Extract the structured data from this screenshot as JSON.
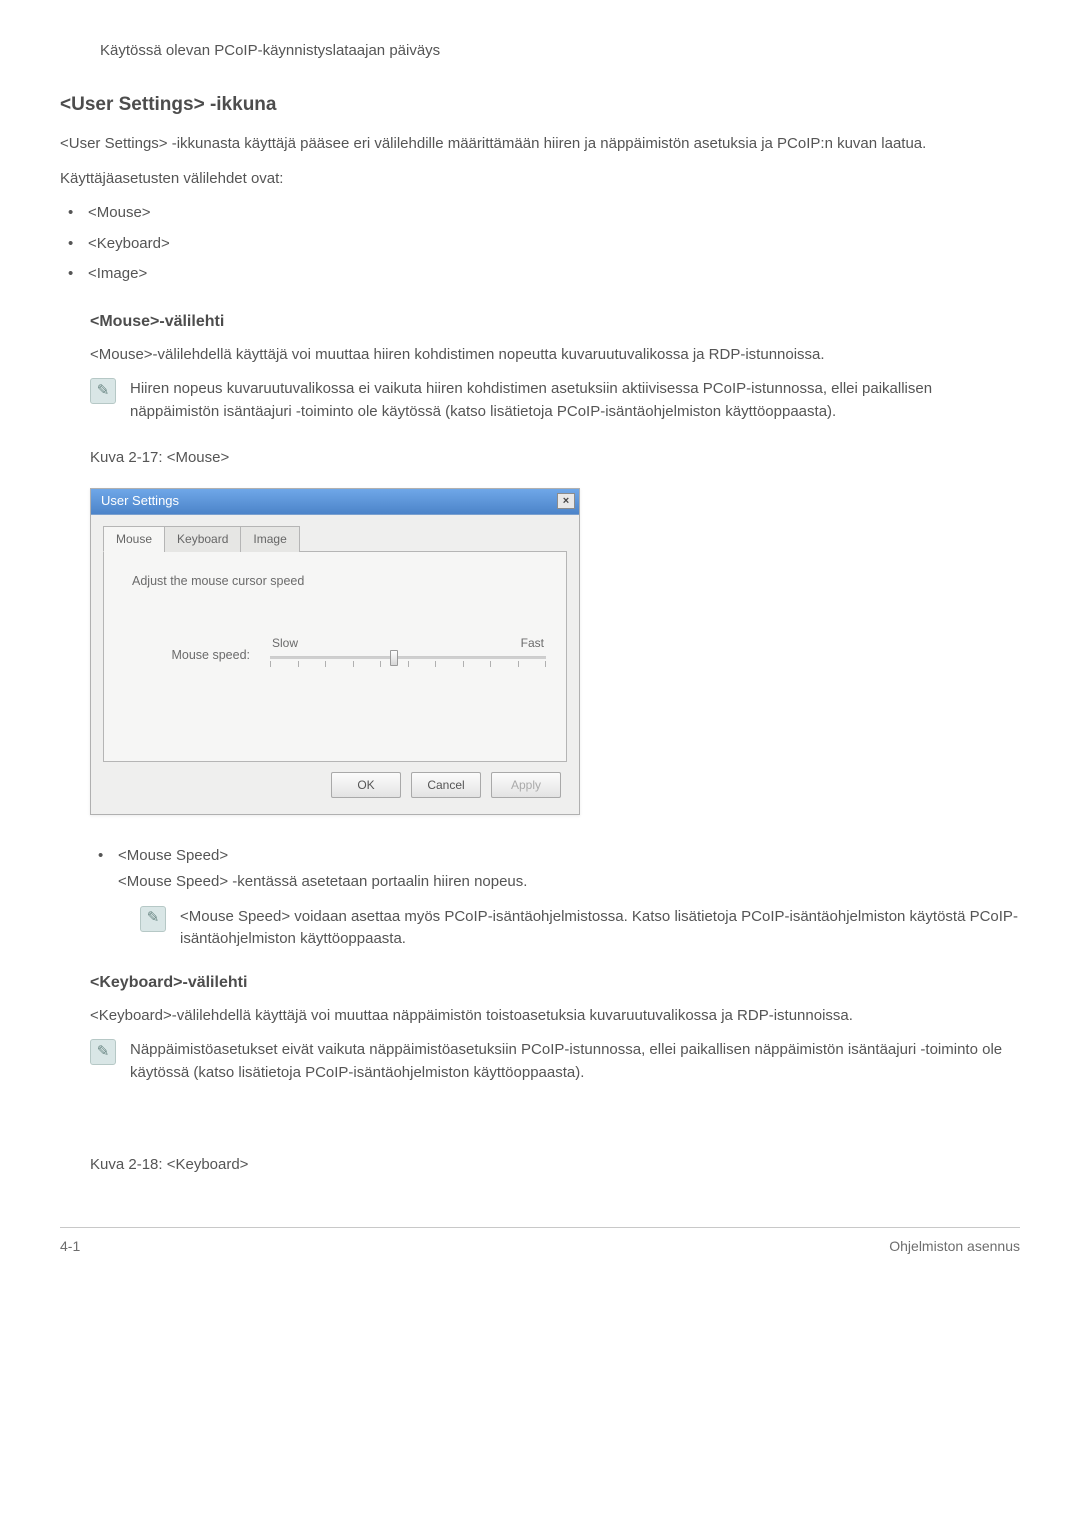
{
  "top_caption": "Käytössä olevan PCoIP-käynnistyslataajan päiväys",
  "section_title": "<User Settings> -ikkuna",
  "intro_p": "<User Settings> -ikkunasta käyttäjä pääsee eri välilehdille määrittämään hiiren ja näppäimistön asetuksia ja PCoIP:n kuvan laatua.",
  "tabs_intro": "Käyttäjäasetusten välilehdet ovat:",
  "tabs_list": [
    "<Mouse>",
    "<Keyboard>",
    "<Image>"
  ],
  "mouse": {
    "heading": "<Mouse>-välilehti",
    "desc": "<Mouse>-välilehdellä käyttäjä voi muuttaa hiiren kohdistimen nopeutta kuvaruutuvalikossa ja RDP-istunnoissa.",
    "note": "Hiiren nopeus kuvaruutuvalikossa ei vaikuta hiiren kohdistimen asetuksiin aktiivisessa PCoIP-istunnossa, ellei paikallisen näppäimistön isäntäajuri -toiminto ole käytössä (katso lisätietoja PCoIP-isäntäohjelmiston käyttöoppaasta).",
    "fig_caption": "Kuva 2-17: <Mouse>"
  },
  "dialog": {
    "title": "User Settings",
    "tabs": {
      "mouse": "Mouse",
      "keyboard": "Keyboard",
      "image": "Image"
    },
    "panel_label": "Adjust the mouse cursor speed",
    "slider_label": "Mouse speed:",
    "slow": "Slow",
    "fast": "Fast",
    "ok": "OK",
    "cancel": "Cancel",
    "apply": "Apply"
  },
  "mouse_speed": {
    "title": "<Mouse Speed>",
    "body": "<Mouse Speed> -kentässä asetetaan portaalin hiiren nopeus.",
    "note": "<Mouse Speed> voidaan asettaa myös PCoIP-isäntäohjelmistossa. Katso lisätietoja PCoIP-isäntäohjelmiston käytöstä PCoIP-isäntäohjelmiston käyttöoppaasta."
  },
  "keyboard": {
    "heading": "<Keyboard>-välilehti",
    "desc": "<Keyboard>-välilehdellä käyttäjä voi muuttaa näppäimistön toistoasetuksia kuvaruutuvalikossa ja RDP-istunnoissa.",
    "note": "Näppäimistöasetukset eivät vaikuta näppäimistöasetuksiin PCoIP-istunnossa, ellei paikallisen näppäimistön isäntäajuri -toiminto ole käytössä (katso lisätietoja PCoIP-isäntäohjelmiston käyttöoppaasta).",
    "fig_caption": "Kuva 2-18: <Keyboard>"
  },
  "footer": {
    "left": "4-1",
    "right": "Ohjelmiston asennus"
  }
}
